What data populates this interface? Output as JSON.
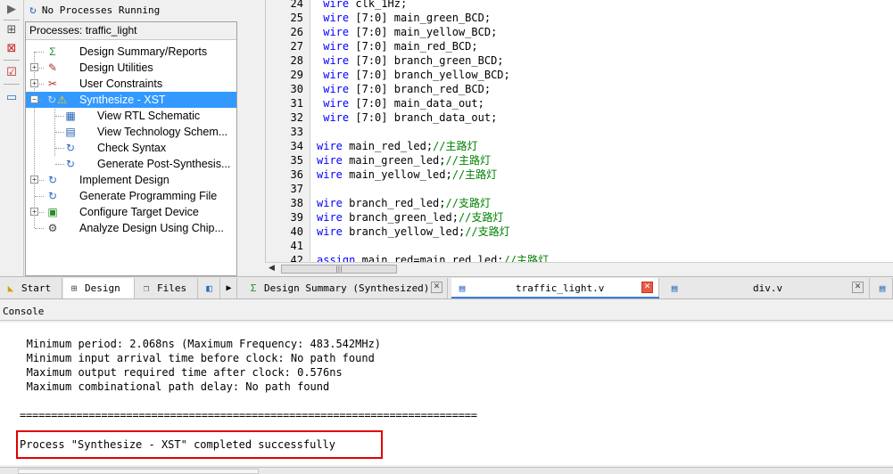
{
  "status": {
    "text": "No Processes Running"
  },
  "processes": {
    "header": "Processes: traffic_light",
    "items": [
      {
        "label": "Design Summary/Reports",
        "icon": "sigma-icon",
        "glyph": "Σ",
        "color": "#1a8f3a"
      },
      {
        "label": "Design Utilities",
        "icon": "tools-icon",
        "glyph": "✎",
        "color": "#b03020"
      },
      {
        "label": "User Constraints",
        "icon": "constraints-icon",
        "glyph": "✂",
        "color": "#b03020"
      },
      {
        "label": "Synthesize - XST",
        "icon": "warning-icon",
        "glyph": "⚠",
        "color": "#e0a000"
      },
      {
        "label": "View RTL Schematic",
        "icon": "schematic-icon",
        "glyph": "▦",
        "color": "#2060b0"
      },
      {
        "label": "View Technology Schem...",
        "icon": "tech-schematic-icon",
        "glyph": "▤",
        "color": "#2060b0"
      },
      {
        "label": "Check Syntax",
        "icon": "refresh-icon",
        "glyph": "↻",
        "color": "#2b6ac0"
      },
      {
        "label": "Generate Post-Synthesis...",
        "icon": "refresh-icon",
        "glyph": "↻",
        "color": "#2b6ac0"
      },
      {
        "label": "Implement Design",
        "icon": "refresh-icon",
        "glyph": "↻",
        "color": "#2b6ac0"
      },
      {
        "label": "Generate Programming File",
        "icon": "refresh-icon",
        "glyph": "↻",
        "color": "#2b6ac0"
      },
      {
        "label": "Configure Target Device",
        "icon": "device-icon",
        "glyph": "▣",
        "color": "#2a8a2a"
      },
      {
        "label": "Analyze Design Using Chip...",
        "icon": "chipscope-icon",
        "glyph": "⚙",
        "color": "#404040"
      }
    ]
  },
  "editor": {
    "lines": [
      {
        "n": "24",
        "kw": "wire",
        "rest": " clk_1Hz;",
        "comment": "",
        "indent": " "
      },
      {
        "n": "25",
        "kw": "wire",
        "rest": " [7:0] main_green_BCD;",
        "comment": "",
        "indent": " "
      },
      {
        "n": "26",
        "kw": "wire",
        "rest": " [7:0] main_yellow_BCD;",
        "comment": "",
        "indent": " "
      },
      {
        "n": "27",
        "kw": "wire",
        "rest": " [7:0] main_red_BCD;",
        "comment": "",
        "indent": " "
      },
      {
        "n": "28",
        "kw": "wire",
        "rest": " [7:0] branch_green_BCD;",
        "comment": "",
        "indent": " "
      },
      {
        "n": "29",
        "kw": "wire",
        "rest": " [7:0] branch_yellow_BCD;",
        "comment": "",
        "indent": " "
      },
      {
        "n": "30",
        "kw": "wire",
        "rest": " [7:0] branch_red_BCD;",
        "comment": "",
        "indent": " "
      },
      {
        "n": "31",
        "kw": "wire",
        "rest": " [7:0] main_data_out;",
        "comment": "",
        "indent": " "
      },
      {
        "n": "32",
        "kw": "wire",
        "rest": " [7:0] branch_data_out;",
        "comment": "",
        "indent": " "
      },
      {
        "n": "33",
        "kw": "",
        "rest": "",
        "comment": "",
        "indent": ""
      },
      {
        "n": "34",
        "kw": "wire",
        "rest": " main_red_led;",
        "comment": "//主路灯",
        "indent": ""
      },
      {
        "n": "35",
        "kw": "wire",
        "rest": " main_green_led;",
        "comment": "//主路灯",
        "indent": ""
      },
      {
        "n": "36",
        "kw": "wire",
        "rest": " main_yellow_led;",
        "comment": "//主路灯",
        "indent": ""
      },
      {
        "n": "37",
        "kw": "",
        "rest": "",
        "comment": "",
        "indent": ""
      },
      {
        "n": "38",
        "kw": "wire",
        "rest": " branch_red_led;",
        "comment": "//支路灯",
        "indent": ""
      },
      {
        "n": "39",
        "kw": "wire",
        "rest": " branch_green_led;",
        "comment": "//支路灯",
        "indent": ""
      },
      {
        "n": "40",
        "kw": "wire",
        "rest": " branch_yellow_led;",
        "comment": "//支路灯",
        "indent": ""
      },
      {
        "n": "41",
        "kw": "",
        "rest": "",
        "comment": "",
        "indent": ""
      },
      {
        "n": "42",
        "kw": "assign",
        "rest": " main_red=main_red_led;",
        "comment": "//主路灯",
        "indent": ""
      }
    ]
  },
  "tabs": {
    "start": "Start",
    "design": "Design",
    "files": "Files",
    "design_summary": "Design Summary (Synthesized)",
    "traffic_light": "traffic_light.v",
    "div": "div.v"
  },
  "console": {
    "title": "Console",
    "lines": [
      "   Minimum period: 2.068ns (Maximum Frequency: 483.542MHz)",
      "   Minimum input arrival time before clock: No path found",
      "   Maximum output required time after clock: 0.576ns",
      "   Maximum combinational path delay: No path found"
    ],
    "separator": "=========================================================================",
    "result": "Process \"Synthesize - XST\" completed successfully"
  }
}
